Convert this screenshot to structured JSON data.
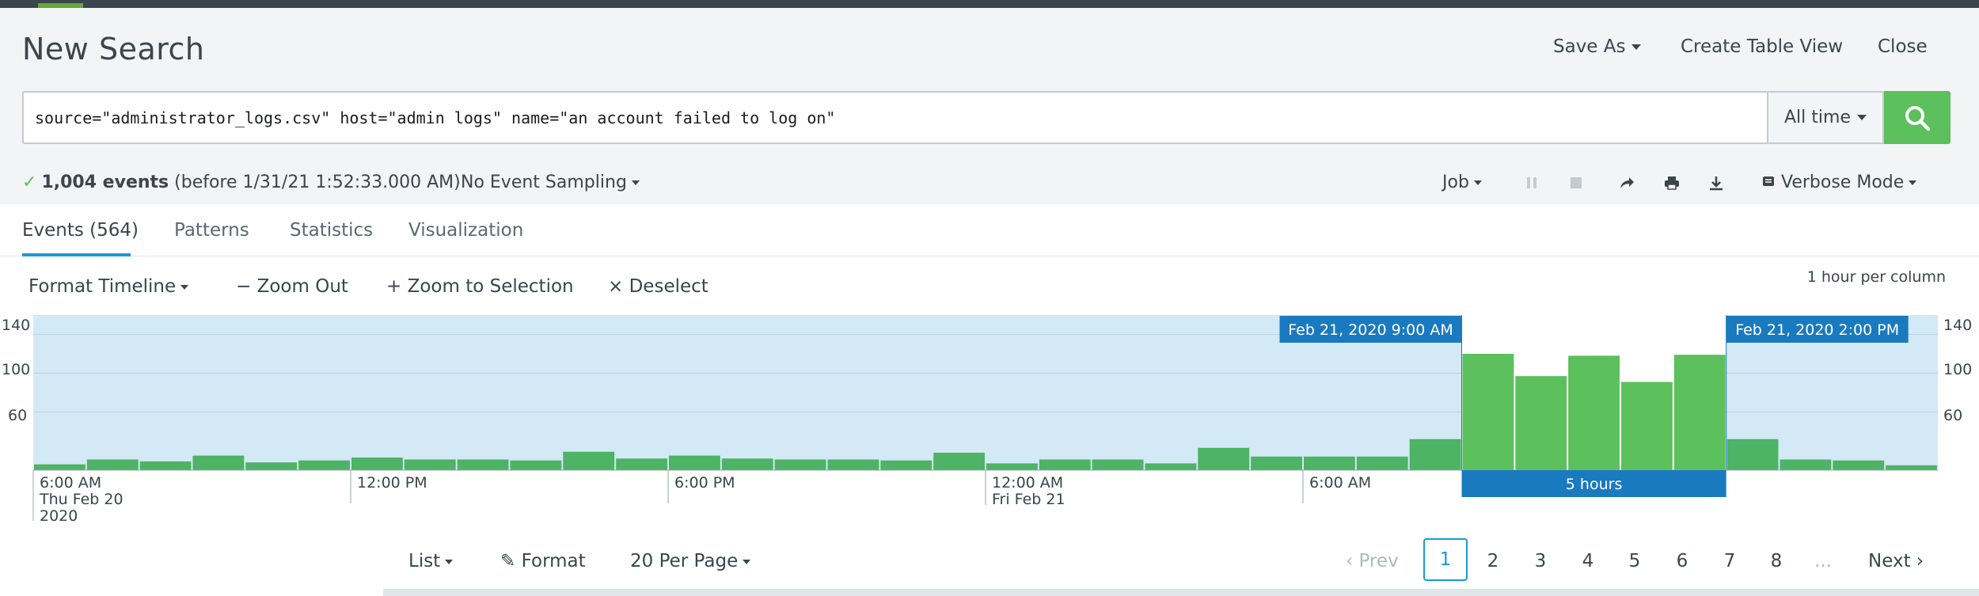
{
  "header": {
    "title": "New Search",
    "save_as": "Save As",
    "create_table_view": "Create Table View",
    "close": "Close"
  },
  "search": {
    "query": "source=\"administrator_logs.csv\" host=\"admin logs\" name=\"an account failed to log on\"",
    "time_range": "All time",
    "search_icon": "magnifier-icon"
  },
  "status": {
    "event_count": "1,004 events",
    "before": "(before 1/31/21 1:52:33.000 AM)",
    "sampling": "No Event Sampling",
    "job": "Job",
    "mode": "Verbose Mode",
    "icons": [
      "pause-icon",
      "stop-icon",
      "share-icon",
      "print-icon",
      "export-icon",
      "mode-icon"
    ]
  },
  "tabs": [
    {
      "label": "Events (564)",
      "active": true
    },
    {
      "label": "Patterns",
      "active": false
    },
    {
      "label": "Statistics",
      "active": false
    },
    {
      "label": "Visualization",
      "active": false
    }
  ],
  "timeline_toolbar": {
    "format_timeline": "Format Timeline",
    "zoom_out": "Zoom Out",
    "zoom_to_selection": "Zoom to Selection",
    "deselect": "Deselect",
    "scale": "1 hour per column"
  },
  "timeline": {
    "y_ticks": [
      "140",
      "100",
      "60"
    ],
    "y_values": [
      140,
      100,
      60
    ],
    "y_max": 160,
    "bars": [
      6,
      11,
      9,
      15,
      8,
      10,
      13,
      11,
      11,
      10,
      19,
      12,
      15,
      12,
      11,
      11,
      10,
      18,
      7,
      11,
      11,
      7,
      23,
      14,
      14,
      14,
      32,
      120,
      97,
      118,
      91,
      119,
      32,
      11,
      10,
      5
    ],
    "selection_start_index": 27,
    "selection_end_index": 31,
    "selection_start_label": "Feb 21, 2020 9:00 AM",
    "selection_end_label": "Feb 21, 2020 2:00 PM",
    "selection_duration": "5 hours",
    "x_labels": [
      {
        "text": "6:00 AM",
        "sub": "Thu Feb 20",
        "sub2": "2020",
        "index": 0
      },
      {
        "text": "12:00 PM",
        "sub": "",
        "sub2": "",
        "index": 6
      },
      {
        "text": "6:00 PM",
        "sub": "",
        "sub2": "",
        "index": 12
      },
      {
        "text": "12:00 AM",
        "sub": "Fri Feb 21",
        "sub2": "",
        "index": 18
      },
      {
        "text": "6:00 AM",
        "sub": "",
        "sub2": "",
        "index": 24
      }
    ],
    "colors": {
      "background": "#d3e9f5",
      "bar": "#4db365",
      "selected_bar": "#5cc05c",
      "selection_label": "#1a7abf"
    }
  },
  "results": {
    "list": "List",
    "format": "Format",
    "per_page": "20 Per Page",
    "prev": "Prev",
    "next": "Next",
    "pages": [
      "1",
      "2",
      "3",
      "4",
      "5",
      "6",
      "7",
      "8"
    ],
    "ellipsis": "...",
    "current_page": "1"
  }
}
